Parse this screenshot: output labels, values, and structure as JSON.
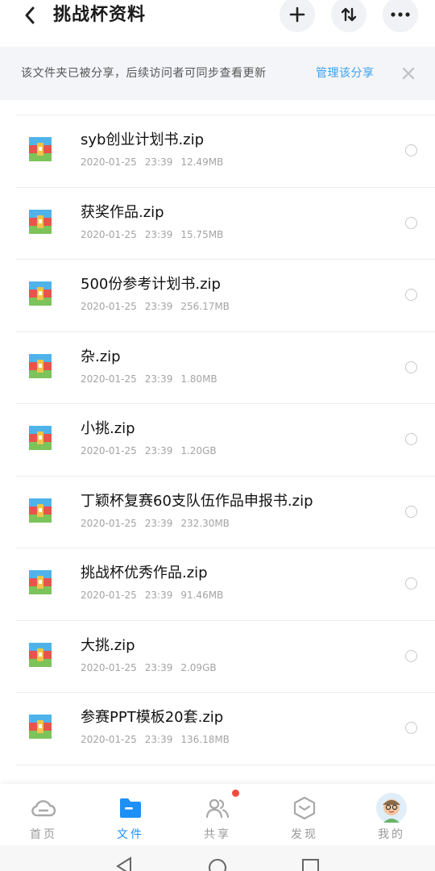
{
  "header": {
    "title": "挑战杯资料"
  },
  "notice": {
    "text": "该文件夹已被分享，后续访问者可同步查看更新",
    "link": "管理该分享"
  },
  "files": [
    {
      "name": "syb创业计划书.zip",
      "date": "2020-01-25",
      "time": "23:39",
      "size": "12.49MB"
    },
    {
      "name": "获奖作品.zip",
      "date": "2020-01-25",
      "time": "23:39",
      "size": "15.75MB"
    },
    {
      "name": "500份参考计划书.zip",
      "date": "2020-01-25",
      "time": "23:39",
      "size": "256.17MB"
    },
    {
      "name": "杂.zip",
      "date": "2020-01-25",
      "time": "23:39",
      "size": "1.80MB"
    },
    {
      "name": "小挑.zip",
      "date": "2020-01-25",
      "time": "23:39",
      "size": "1.20GB"
    },
    {
      "name": "丁颖杯复赛60支队伍作品申报书.zip",
      "date": "2020-01-25",
      "time": "23:39",
      "size": "232.30MB"
    },
    {
      "name": "挑战杯优秀作品.zip",
      "date": "2020-01-25",
      "time": "23:39",
      "size": "91.46MB"
    },
    {
      "name": "大挑.zip",
      "date": "2020-01-25",
      "time": "23:39",
      "size": "2.09GB"
    },
    {
      "name": "参赛PPT模板20套.zip",
      "date": "2020-01-25",
      "time": "23:39",
      "size": "136.18MB"
    }
  ],
  "nav": {
    "home": "首页",
    "files": "文件",
    "share": "共享",
    "discover": "发现",
    "me": "我的"
  },
  "colors": {
    "accent": "#1e90f5",
    "link": "#3aa0ee",
    "badge": "#f24a3e"
  }
}
